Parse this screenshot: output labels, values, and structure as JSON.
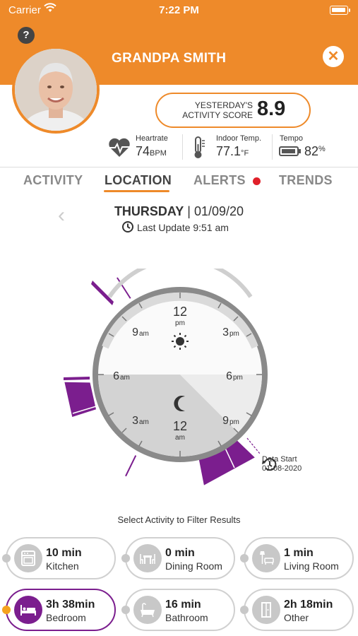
{
  "status_bar": {
    "carrier": "Carrier",
    "time": "7:22 PM"
  },
  "header": {
    "help": "?",
    "name": "GRANDPA SMITH",
    "close": "✕",
    "score_label_line1": "YESTERDAY'S",
    "score_label_line2": "ACTIVITY SCORE",
    "score_value": "8.9"
  },
  "stats": [
    {
      "title": "Heartrate",
      "value": "74",
      "unit": "BPM",
      "icon": "heart-pulse-icon"
    },
    {
      "title": "Indoor Temp.",
      "value": "77.1",
      "unit": "°F",
      "icon": "thermometer-icon"
    },
    {
      "title": "Tempo",
      "value": "82",
      "unit": "%",
      "icon": "battery-icon"
    }
  ],
  "tabs": [
    {
      "label": "ACTIVITY",
      "active": false
    },
    {
      "label": "LOCATION",
      "active": true
    },
    {
      "label": "ALERTS",
      "active": false,
      "has_alert": true
    },
    {
      "label": "TRENDS",
      "active": false
    }
  ],
  "date": {
    "day": "THURSDAY",
    "date": "01/09/20",
    "last_update": "Last Update 9:51 am"
  },
  "clock": {
    "labels": {
      "top": "12",
      "top_sub": "pm",
      "bottom": "12",
      "bottom_sub": "am",
      "nine_am": "9",
      "nine_am_sub": "am",
      "three_pm": "3",
      "three_pm_sub": "pm",
      "six_am": "6",
      "six_am_sub": "am",
      "six_pm": "6",
      "six_pm_sub": "pm",
      "three_am": "3",
      "three_am_sub": "am",
      "nine_pm": "9",
      "nine_pm_sub": "pm"
    },
    "data_start_label": "Data Start",
    "data_start_date": "01-08-2020",
    "colors": {
      "activity": "#7B1E8E",
      "night": "#D6D6D6",
      "day": "#F2F2F2",
      "ring": "#888888"
    }
  },
  "filter": {
    "title": "Select Activity to Filter Results",
    "items": [
      {
        "duration": "10 min",
        "room": "Kitchen",
        "icon": "stove-icon",
        "active": false
      },
      {
        "duration": "0 min",
        "room": "Dining Room",
        "icon": "dining-table-icon",
        "active": false
      },
      {
        "duration": "1 min",
        "room": "Living Room",
        "icon": "couch-lamp-icon",
        "active": false
      },
      {
        "duration": "3h 38min",
        "room": "Bedroom",
        "icon": "bed-icon",
        "active": true
      },
      {
        "duration": "16 min",
        "room": "Bathroom",
        "icon": "bathtub-icon",
        "active": false
      },
      {
        "duration": "2h 18min",
        "room": "Other",
        "icon": "door-icon",
        "active": false
      }
    ]
  },
  "colors": {
    "brand": "#EE8A2A",
    "accent": "#7B1E8E",
    "alert": "#E0202A"
  }
}
